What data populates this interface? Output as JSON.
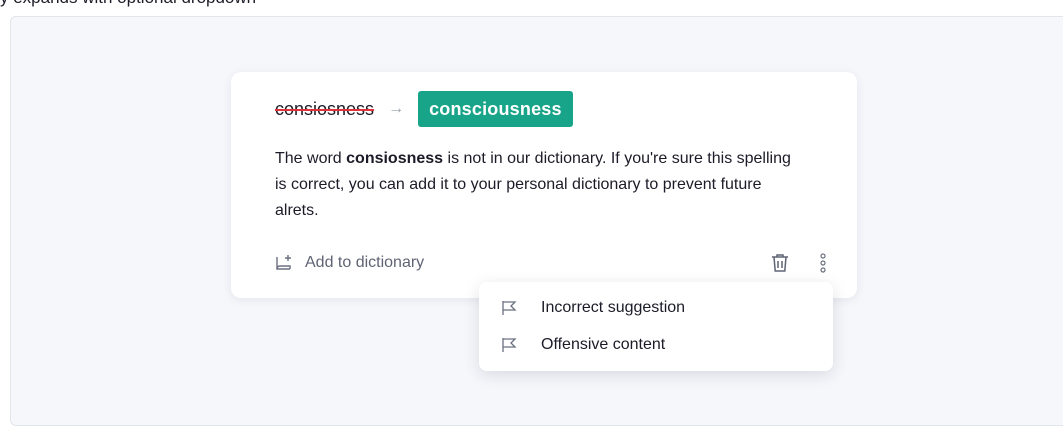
{
  "caption": "y expands with optional dropdown",
  "card": {
    "wrong_word": "consiosness",
    "arrow": "→",
    "suggestion": "consciousness",
    "explanation": {
      "before": "The word ",
      "highlight": "consiosness",
      "after": " is not in our dictionary. If you're sure this spelling is correct, you can add it to your personal dictionary to prevent future alrets."
    },
    "add_to_dictionary": "Add to dictionary"
  },
  "menu": {
    "items": [
      {
        "label": "Incorrect suggestion",
        "icon": "flag-icon"
      },
      {
        "label": "Offensive content",
        "icon": "flag-icon"
      }
    ]
  },
  "colors": {
    "accent": "#17a488",
    "strike": "#e0323b",
    "background": "#f6f7fb"
  }
}
